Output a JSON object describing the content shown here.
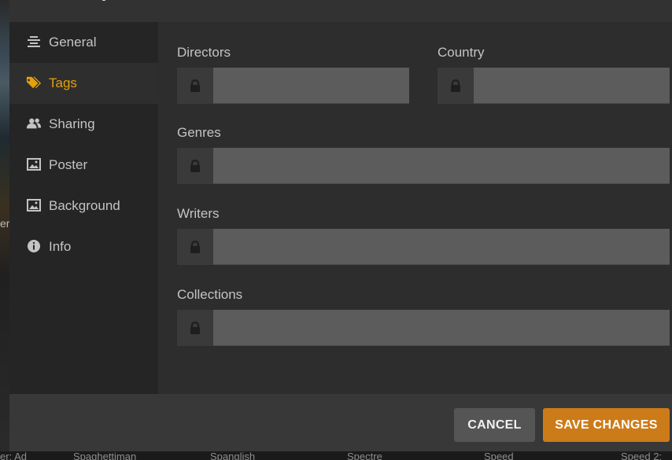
{
  "background": {
    "left_fragment": "ers",
    "bottom_titles": [
      "er: Ad",
      "Spaghettiman",
      "Spanglish",
      "Spectre",
      "Speed",
      "Speed 2:"
    ]
  },
  "sidebar": {
    "items": [
      {
        "label": "General",
        "icon": "align-center-icon"
      },
      {
        "label": "Tags",
        "icon": "tags-icon",
        "active": true
      },
      {
        "label": "Sharing",
        "icon": "users-icon"
      },
      {
        "label": "Poster",
        "icon": "image-icon"
      },
      {
        "label": "Background",
        "icon": "image-icon"
      },
      {
        "label": "Info",
        "icon": "info-icon"
      }
    ]
  },
  "fields": {
    "directors": {
      "label": "Directors",
      "value": ""
    },
    "country": {
      "label": "Country",
      "value": ""
    },
    "genres": {
      "label": "Genres",
      "value": ""
    },
    "writers": {
      "label": "Writers",
      "value": ""
    },
    "collections": {
      "label": "Collections",
      "value": ""
    }
  },
  "footer": {
    "cancel_label": "CANCEL",
    "save_label": "SAVE CHANGES"
  },
  "colors": {
    "accent": "#e5a00d",
    "save_button": "#cc7b19",
    "cancel_button": "#555555",
    "input_bg": "#5c5c5c"
  }
}
